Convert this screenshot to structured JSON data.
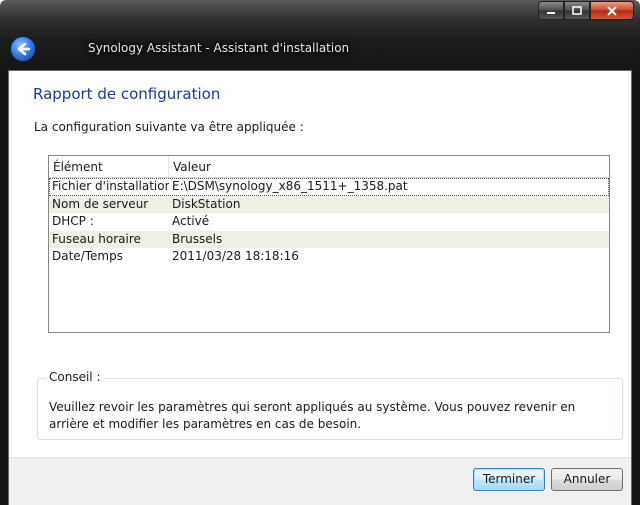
{
  "window": {
    "title": "Synology Assistant - Assistant d'installation"
  },
  "page": {
    "heading": "Rapport de configuration",
    "subtext": "La configuration suivante va être appliquée :"
  },
  "listview": {
    "columns": [
      "Élément",
      "Valeur"
    ],
    "rows": [
      {
        "key": "Fichier d'installation",
        "value": "E:\\DSM\\synology_x86_1511+_1358.pat"
      },
      {
        "key": "Nom de serveur",
        "value": "DiskStation"
      },
      {
        "key": "DHCP :",
        "value": "Activé"
      },
      {
        "key": "Fuseau horaire",
        "value": "Brussels"
      },
      {
        "key": "Date/Temps",
        "value": "2011/03/28 18:18:16"
      }
    ]
  },
  "tip": {
    "legend": "Conseil :",
    "text": "Veuillez revoir les paramètres qui seront appliqués au système. Vous pouvez revenir en arrière et modifier les paramètres en cas de besoin."
  },
  "footer": {
    "finish_label": "Terminer",
    "cancel_label": "Annuler"
  },
  "icons": {
    "back": "back-arrow-icon",
    "minimize": "minimize-icon",
    "maximize": "maximize-icon",
    "close": "close-icon"
  }
}
